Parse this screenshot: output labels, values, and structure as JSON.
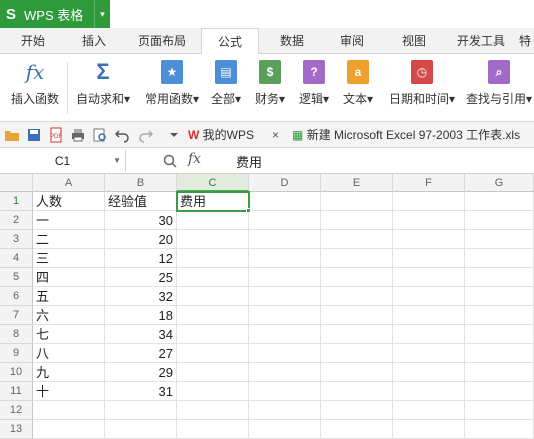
{
  "app": {
    "logo": "S",
    "name": "WPS 表格",
    "dropdown": "▾"
  },
  "tabs": [
    "开始",
    "插入",
    "页面布局",
    "公式",
    "数据",
    "审阅",
    "视图",
    "开发工具",
    "特"
  ],
  "active_tab": "公式",
  "ribbon": {
    "buttons": [
      {
        "label": "插入函数",
        "icon": "fx-icon",
        "glyph": "fx"
      },
      {
        "label": "自动求和",
        "icon": "sum-icon",
        "glyph": "Σ",
        "dropdown": "▾"
      },
      {
        "label": "常用函数",
        "icon": "star-icon",
        "glyph": "★",
        "dropdown": "▾"
      },
      {
        "label": "全部",
        "icon": "book-icon",
        "glyph": "▤",
        "dropdown": "▾"
      },
      {
        "label": "财务",
        "icon": "finance-icon",
        "glyph": "$",
        "dropdown": "▾"
      },
      {
        "label": "逻辑",
        "icon": "logic-icon",
        "glyph": "?",
        "dropdown": "▾"
      },
      {
        "label": "文本",
        "icon": "text-icon",
        "glyph": "a",
        "dropdown": "▾"
      },
      {
        "label": "日期和时间",
        "icon": "clock-icon",
        "glyph": "◷",
        "dropdown": "▾"
      },
      {
        "label": "查找与引用",
        "icon": "search-icon",
        "glyph": "⌕",
        "dropdown": "▾"
      }
    ],
    "colors": {
      "fx": "#3b6fb6",
      "sum": "#3b6fb6",
      "star": "#4a8fd8",
      "book": "#4a8fd8",
      "finance": "#5aa05a",
      "logic": "#a26ac9",
      "text": "#f0a030",
      "clock": "#d24a4a",
      "search": "#a26ac9"
    }
  },
  "doc_tabs": {
    "home_label": "我的WPS",
    "close": "×",
    "doc_label": "新建 Microsoft Excel 97-2003 工作表.xls"
  },
  "formula_bar": {
    "name_box": "C1",
    "fx": "fx",
    "content": "费用"
  },
  "columns": [
    "A",
    "B",
    "C",
    "D",
    "E",
    "F",
    "G"
  ],
  "rows": [
    "1",
    "2",
    "3",
    "4",
    "5",
    "6",
    "7",
    "8",
    "9",
    "10",
    "11",
    "12",
    "13"
  ],
  "cells": {
    "A": [
      "人数",
      "一",
      "二",
      "三",
      "四",
      "五",
      "六",
      "七",
      "八",
      "九",
      "十",
      "",
      ""
    ],
    "B": [
      "经验值",
      "30",
      "20",
      "12",
      "25",
      "32",
      "18",
      "34",
      "27",
      "29",
      "31",
      "",
      ""
    ],
    "C": [
      "费用",
      "",
      "",
      "",
      "",
      "",
      "",
      "",
      "",
      "",
      "",
      "",
      ""
    ]
  },
  "selected_cell": "C1",
  "accent": "#2e9a3c"
}
